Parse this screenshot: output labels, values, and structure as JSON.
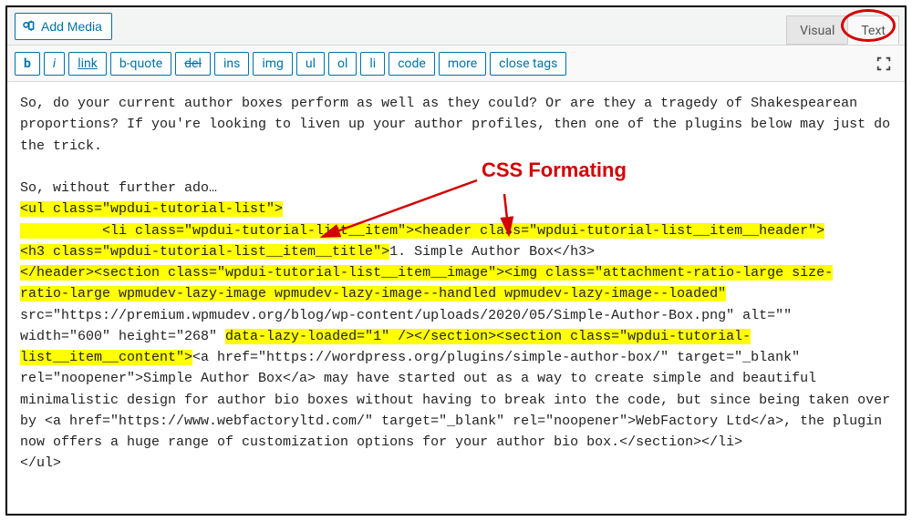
{
  "toolbar": {
    "add_media_label": "Add Media",
    "tab_visual": "Visual",
    "tab_text": "Text",
    "buttons": {
      "b": "b",
      "i": "i",
      "link": "link",
      "bquote": "b-quote",
      "del": "del",
      "ins": "ins",
      "img": "img",
      "ul": "ul",
      "ol": "ol",
      "li": "li",
      "code": "code",
      "more": "more",
      "close_tags": "close tags"
    }
  },
  "content": {
    "p1": "So, do your current author boxes perform as well as they could? Or are they a tragedy of Shakespearean proportions? If you're looking to liven up your author profiles, then one of the plugins below may just do the trick.",
    "p2": "So, without further ado…",
    "c1": "<ul class=\"wpdui-tutorial-list\">",
    "c2_indent": "          ",
    "c2": "<li class=\"wpdui-tutorial-list__item\"><header class=\"wpdui-tutorial-list__item__header\">",
    "c3a": "<h3 class=\"wpdui-tutorial-list__item__title\">",
    "c3b": "1. Simple Author Box</h3>",
    "c4a": "</header><section class=\"wpdui-tutorial-list__item__image\"><img class=\"attachment-ratio-large size-",
    "c4b": "ratio-large wpmudev-lazy-image wpmudev-lazy-image--handled wpmudev-lazy-image--loaded\"",
    "c5": "src=\"https://premium.wpmudev.org/blog/wp-content/uploads/2020/05/Simple-Author-Box.png\" alt=\"\"",
    "c6a": "width=\"600\" height=\"268\" ",
    "c6b": "data-lazy-loaded=\"1\" /></section><section class=\"wpdui-tutorial-",
    "c6c": "list__item__content\">",
    "c6d": "<a href=\"https://wordpress.org/plugins/simple-author-box/\" target=\"_blank\"",
    "c7": "rel=\"noopener\">Simple Author Box</a> may have started out as a way to create simple and beautiful minimalistic design for author bio boxes without having to break into the code, but since being taken over by <a href=\"https://www.webfactoryltd.com/\" target=\"_blank\" rel=\"noopener\">WebFactory Ltd</a>, the plugin now offers a huge range of customization options for your author bio box.</section></li>",
    "c8": "</ul>"
  },
  "annotation": {
    "label": "CSS Formating"
  }
}
